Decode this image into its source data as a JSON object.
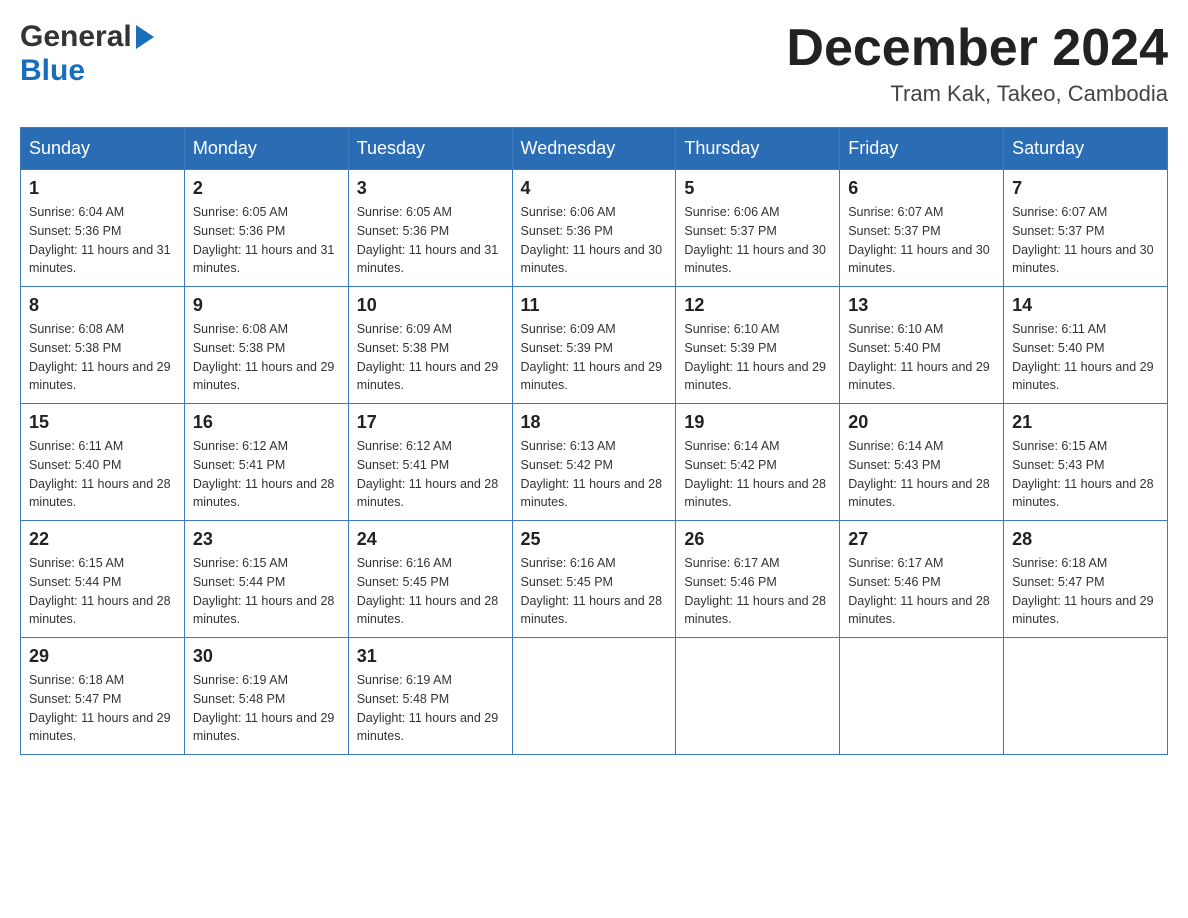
{
  "header": {
    "logo_general": "General",
    "logo_blue": "Blue",
    "month_title": "December 2024",
    "location": "Tram Kak, Takeo, Cambodia"
  },
  "weekdays": [
    "Sunday",
    "Monday",
    "Tuesday",
    "Wednesday",
    "Thursday",
    "Friday",
    "Saturday"
  ],
  "weeks": [
    [
      {
        "day": "1",
        "sunrise": "6:04 AM",
        "sunset": "5:36 PM",
        "daylight": "11 hours and 31 minutes."
      },
      {
        "day": "2",
        "sunrise": "6:05 AM",
        "sunset": "5:36 PM",
        "daylight": "11 hours and 31 minutes."
      },
      {
        "day": "3",
        "sunrise": "6:05 AM",
        "sunset": "5:36 PM",
        "daylight": "11 hours and 31 minutes."
      },
      {
        "day": "4",
        "sunrise": "6:06 AM",
        "sunset": "5:36 PM",
        "daylight": "11 hours and 30 minutes."
      },
      {
        "day": "5",
        "sunrise": "6:06 AM",
        "sunset": "5:37 PM",
        "daylight": "11 hours and 30 minutes."
      },
      {
        "day": "6",
        "sunrise": "6:07 AM",
        "sunset": "5:37 PM",
        "daylight": "11 hours and 30 minutes."
      },
      {
        "day": "7",
        "sunrise": "6:07 AM",
        "sunset": "5:37 PM",
        "daylight": "11 hours and 30 minutes."
      }
    ],
    [
      {
        "day": "8",
        "sunrise": "6:08 AM",
        "sunset": "5:38 PM",
        "daylight": "11 hours and 29 minutes."
      },
      {
        "day": "9",
        "sunrise": "6:08 AM",
        "sunset": "5:38 PM",
        "daylight": "11 hours and 29 minutes."
      },
      {
        "day": "10",
        "sunrise": "6:09 AM",
        "sunset": "5:38 PM",
        "daylight": "11 hours and 29 minutes."
      },
      {
        "day": "11",
        "sunrise": "6:09 AM",
        "sunset": "5:39 PM",
        "daylight": "11 hours and 29 minutes."
      },
      {
        "day": "12",
        "sunrise": "6:10 AM",
        "sunset": "5:39 PM",
        "daylight": "11 hours and 29 minutes."
      },
      {
        "day": "13",
        "sunrise": "6:10 AM",
        "sunset": "5:40 PM",
        "daylight": "11 hours and 29 minutes."
      },
      {
        "day": "14",
        "sunrise": "6:11 AM",
        "sunset": "5:40 PM",
        "daylight": "11 hours and 29 minutes."
      }
    ],
    [
      {
        "day": "15",
        "sunrise": "6:11 AM",
        "sunset": "5:40 PM",
        "daylight": "11 hours and 28 minutes."
      },
      {
        "day": "16",
        "sunrise": "6:12 AM",
        "sunset": "5:41 PM",
        "daylight": "11 hours and 28 minutes."
      },
      {
        "day": "17",
        "sunrise": "6:12 AM",
        "sunset": "5:41 PM",
        "daylight": "11 hours and 28 minutes."
      },
      {
        "day": "18",
        "sunrise": "6:13 AM",
        "sunset": "5:42 PM",
        "daylight": "11 hours and 28 minutes."
      },
      {
        "day": "19",
        "sunrise": "6:14 AM",
        "sunset": "5:42 PM",
        "daylight": "11 hours and 28 minutes."
      },
      {
        "day": "20",
        "sunrise": "6:14 AM",
        "sunset": "5:43 PM",
        "daylight": "11 hours and 28 minutes."
      },
      {
        "day": "21",
        "sunrise": "6:15 AM",
        "sunset": "5:43 PM",
        "daylight": "11 hours and 28 minutes."
      }
    ],
    [
      {
        "day": "22",
        "sunrise": "6:15 AM",
        "sunset": "5:44 PM",
        "daylight": "11 hours and 28 minutes."
      },
      {
        "day": "23",
        "sunrise": "6:15 AM",
        "sunset": "5:44 PM",
        "daylight": "11 hours and 28 minutes."
      },
      {
        "day": "24",
        "sunrise": "6:16 AM",
        "sunset": "5:45 PM",
        "daylight": "11 hours and 28 minutes."
      },
      {
        "day": "25",
        "sunrise": "6:16 AM",
        "sunset": "5:45 PM",
        "daylight": "11 hours and 28 minutes."
      },
      {
        "day": "26",
        "sunrise": "6:17 AM",
        "sunset": "5:46 PM",
        "daylight": "11 hours and 28 minutes."
      },
      {
        "day": "27",
        "sunrise": "6:17 AM",
        "sunset": "5:46 PM",
        "daylight": "11 hours and 28 minutes."
      },
      {
        "day": "28",
        "sunrise": "6:18 AM",
        "sunset": "5:47 PM",
        "daylight": "11 hours and 29 minutes."
      }
    ],
    [
      {
        "day": "29",
        "sunrise": "6:18 AM",
        "sunset": "5:47 PM",
        "daylight": "11 hours and 29 minutes."
      },
      {
        "day": "30",
        "sunrise": "6:19 AM",
        "sunset": "5:48 PM",
        "daylight": "11 hours and 29 minutes."
      },
      {
        "day": "31",
        "sunrise": "6:19 AM",
        "sunset": "5:48 PM",
        "daylight": "11 hours and 29 minutes."
      },
      null,
      null,
      null,
      null
    ]
  ]
}
